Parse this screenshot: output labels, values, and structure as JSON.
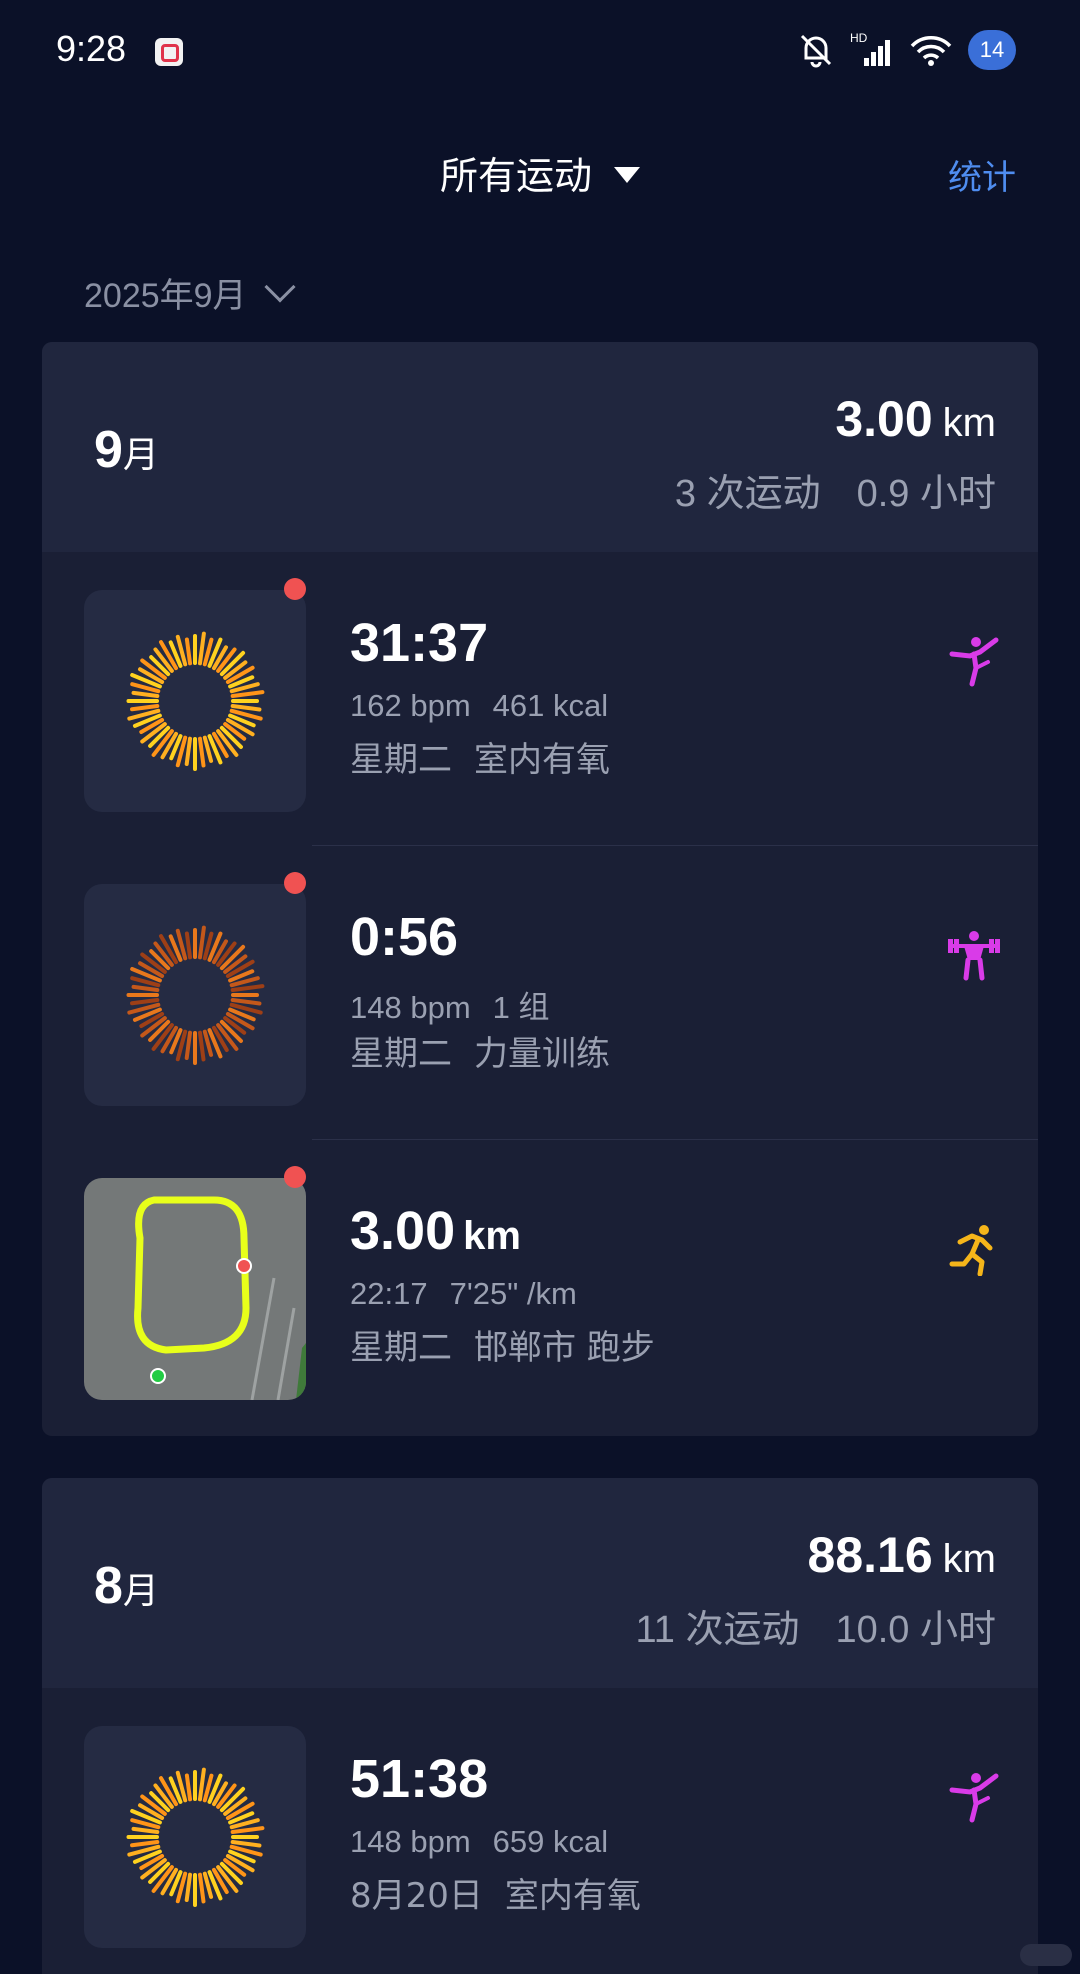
{
  "status_bar": {
    "time": "9:28",
    "battery": "14"
  },
  "header": {
    "title": "所有运动",
    "stats_link": "统计"
  },
  "month_picker": {
    "label": "2025年9月"
  },
  "months": [
    {
      "num": "9",
      "unit": "月",
      "distance": "3.00",
      "distance_unit": "km",
      "count": "3 次运动",
      "hours": "0.9 小时",
      "workouts": [
        {
          "main": "31:37",
          "main_unit": "",
          "stat1": "162 bpm",
          "stat2": "461 kcal",
          "day": "星期二",
          "type": "室内有氧",
          "icon": "yoga-icon",
          "icon_color": "#d93be8"
        },
        {
          "main": "0:56",
          "main_unit": "",
          "stat1": "148 bpm",
          "stat2": "1 组",
          "day": "星期二",
          "type": "力量训练",
          "icon": "weightlifting-icon",
          "icon_color": "#d93be8"
        },
        {
          "main": "3.00",
          "main_unit": "km",
          "stat1": "22:17",
          "stat2": "7'25\" /km",
          "day": "星期二",
          "type": "邯郸市 跑步",
          "icon": "running-icon",
          "icon_color": "#f5b51a"
        }
      ]
    },
    {
      "num": "8",
      "unit": "月",
      "distance": "88.16",
      "distance_unit": "km",
      "count": "11 次运动",
      "hours": "10.0 小时",
      "workouts": [
        {
          "main": "51:38",
          "main_unit": "",
          "stat1": "148 bpm",
          "stat2": "659 kcal",
          "day": "8月20日",
          "type": "室内有氧",
          "icon": "yoga-icon",
          "icon_color": "#d93be8"
        }
      ]
    }
  ],
  "colors": {
    "background": "#0b1128",
    "card": "#1a1f35",
    "card_header": "#20263e",
    "accent_blue": "#4f8df0",
    "dot_red": "#f05252"
  }
}
